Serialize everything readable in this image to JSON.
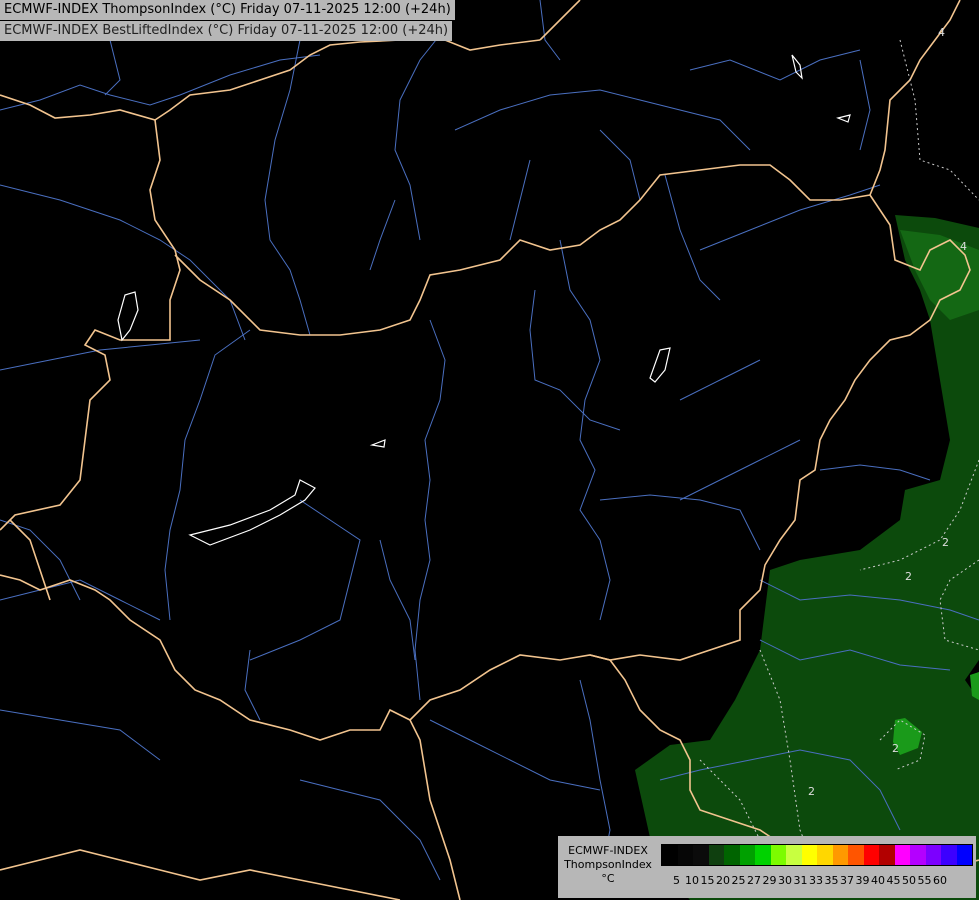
{
  "titles": {
    "line1": "ECMWF-INDEX ThompsonIndex (°C) Friday 07-11-2025 12:00 (+24h)",
    "line2": "ECMWF-INDEX BestLiftedIndex (°C) Friday 07-11-2025 12:00 (+24h)"
  },
  "legend": {
    "model": "ECMWF-INDEX",
    "parameter": "ThompsonIndex",
    "unit": "°C",
    "values": [
      "5",
      "10",
      "15",
      "20",
      "25",
      "27",
      "29",
      "30",
      "31",
      "33",
      "35",
      "37",
      "39",
      "40",
      "45",
      "50",
      "55",
      "60"
    ],
    "colors": [
      "#000000",
      "#060606",
      "#0b0b0b",
      "#0f3f0f",
      "#006400",
      "#00a000",
      "#00d200",
      "#7cfc00",
      "#c8ff40",
      "#ffff00",
      "#ffd700",
      "#ff9900",
      "#ff5500",
      "#ff0000",
      "#b20000",
      "#ff00ff",
      "#b400ff",
      "#7c00ff",
      "#3c00ff",
      "#0000ff"
    ]
  },
  "colors": {
    "background": "#000000",
    "border": "#f2c48f",
    "river": "#4a6fc0",
    "lake": "#ffffff",
    "green_dark": "#0c4a0c",
    "green_mid": "#146814",
    "green_bright": "#1a9a1a",
    "contour": "#cccccc"
  },
  "contour_labels": [
    "2",
    "2",
    "2",
    "4",
    "4",
    "2"
  ]
}
